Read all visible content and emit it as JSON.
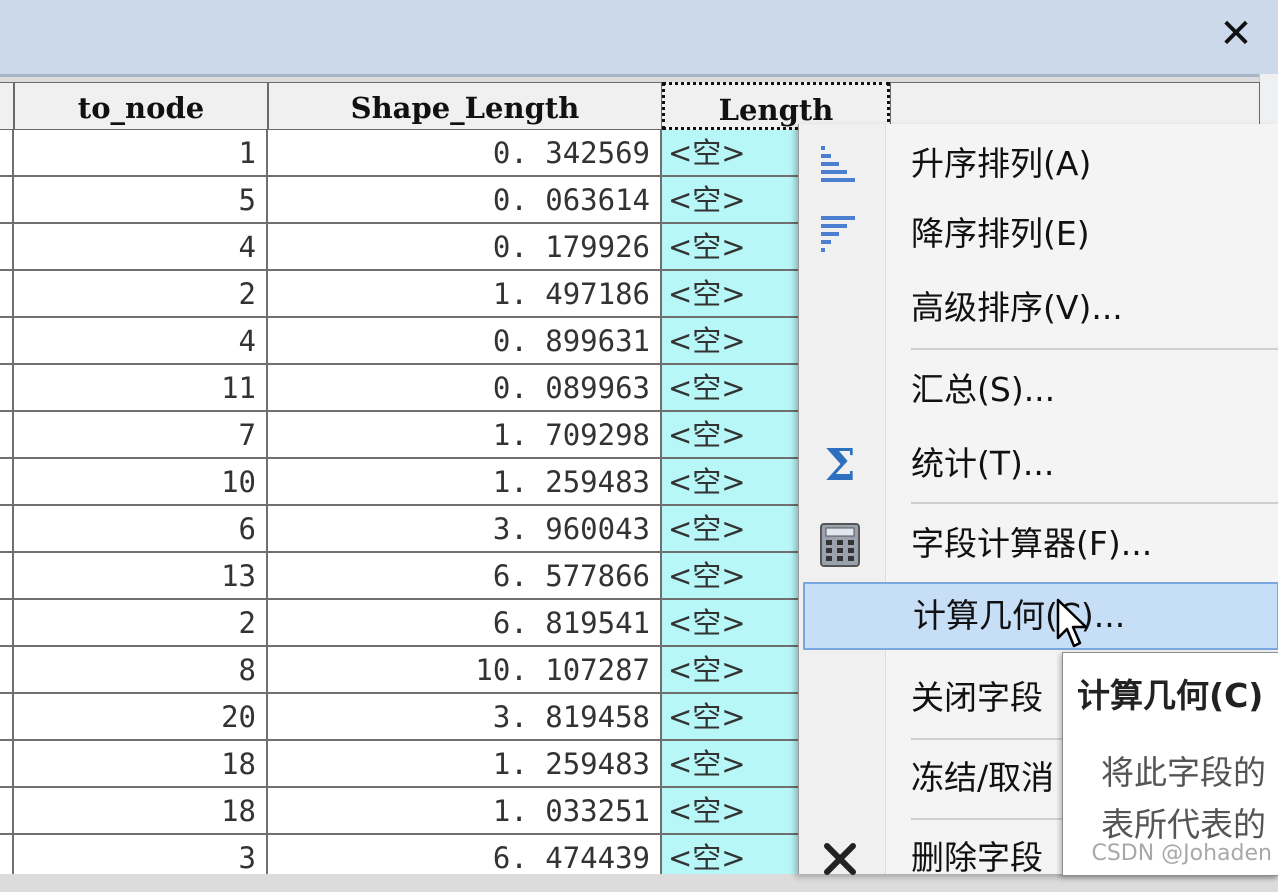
{
  "window": {
    "close_glyph": "✕"
  },
  "table": {
    "columns": [
      "to_node",
      "Shape_Length",
      "Length"
    ],
    "rows": [
      {
        "to_node": "1",
        "shape_length": "0. 342569",
        "length": "<空>"
      },
      {
        "to_node": "5",
        "shape_length": "0. 063614",
        "length": "<空>"
      },
      {
        "to_node": "4",
        "shape_length": "0. 179926",
        "length": "<空>"
      },
      {
        "to_node": "2",
        "shape_length": "1. 497186",
        "length": "<空>"
      },
      {
        "to_node": "4",
        "shape_length": "0. 899631",
        "length": "<空>"
      },
      {
        "to_node": "11",
        "shape_length": "0. 089963",
        "length": "<空>"
      },
      {
        "to_node": "7",
        "shape_length": "1. 709298",
        "length": "<空>"
      },
      {
        "to_node": "10",
        "shape_length": "1. 259483",
        "length": "<空>"
      },
      {
        "to_node": "6",
        "shape_length": "3. 960043",
        "length": "<空>"
      },
      {
        "to_node": "13",
        "shape_length": "6. 577866",
        "length": "<空>"
      },
      {
        "to_node": "2",
        "shape_length": "6. 819541",
        "length": "<空>"
      },
      {
        "to_node": "8",
        "shape_length": "10. 107287",
        "length": "<空>"
      },
      {
        "to_node": "20",
        "shape_length": "3. 819458",
        "length": "<空>"
      },
      {
        "to_node": "18",
        "shape_length": "1. 259483",
        "length": "<空>"
      },
      {
        "to_node": "18",
        "shape_length": "1. 033251",
        "length": "<空>"
      },
      {
        "to_node": "3",
        "shape_length": "6. 474439",
        "length": "<空>"
      }
    ],
    "null_color": "#b7f7f7"
  },
  "context_menu": {
    "items": [
      {
        "label": "升序排列(A)",
        "icon": "sort-ascending-icon"
      },
      {
        "label": "降序排列(E)",
        "icon": "sort-descending-icon"
      },
      {
        "label": "高级排序(V)...",
        "icon": ""
      },
      {
        "label": "汇总(S)...",
        "icon": ""
      },
      {
        "label": "统计(T)...",
        "icon": "sigma-icon"
      },
      {
        "label": "字段计算器(F)...",
        "icon": "calculator-icon"
      },
      {
        "label": "计算几何(C)...",
        "icon": "",
        "highlighted": true
      },
      {
        "label": "关闭字段",
        "icon": ""
      },
      {
        "label": "冻结/取消",
        "icon": ""
      },
      {
        "label": "删除字段",
        "icon": "delete-icon"
      }
    ],
    "highlight_color": "#c7def7"
  },
  "tooltip": {
    "title": "计算几何(C)",
    "line1": "将此字段的",
    "line2": "表所代表的"
  },
  "watermark": "CSDN @Johaden"
}
